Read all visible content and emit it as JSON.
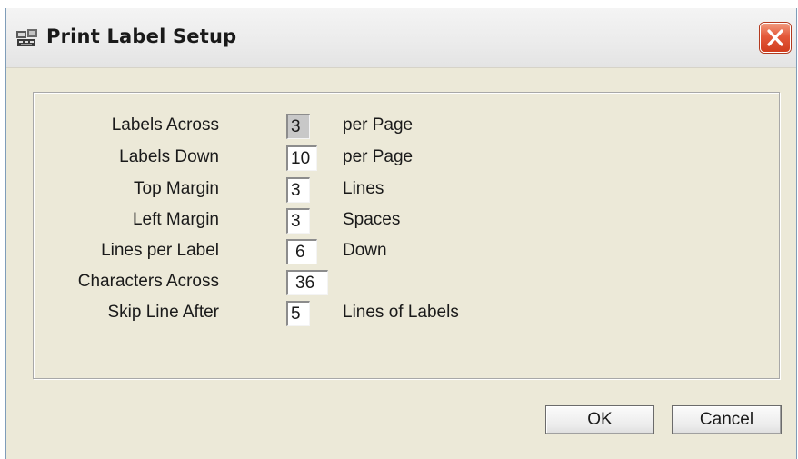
{
  "window": {
    "title": "Print Label Setup",
    "icon": "app-icon",
    "close_icon": "close-icon"
  },
  "form": {
    "rows": [
      {
        "label": "Labels Across",
        "value": "3",
        "unit": "per Page"
      },
      {
        "label": "Labels Down",
        "value": "10",
        "unit": "per Page"
      },
      {
        "label": "Top Margin",
        "value": "3",
        "unit": "Lines"
      },
      {
        "label": "Left Margin",
        "value": "3",
        "unit": "Spaces"
      },
      {
        "label": "Lines per Label",
        "value": "6",
        "unit": "Down"
      },
      {
        "label": "Characters Across",
        "value": "36",
        "unit": ""
      },
      {
        "label": "Skip Line After",
        "value": "5",
        "unit": "Lines of Labels"
      }
    ]
  },
  "buttons": {
    "ok": "OK",
    "cancel": "Cancel"
  },
  "colors": {
    "dialog_bg": "#ece9d8",
    "close_button": "#e4593a"
  }
}
